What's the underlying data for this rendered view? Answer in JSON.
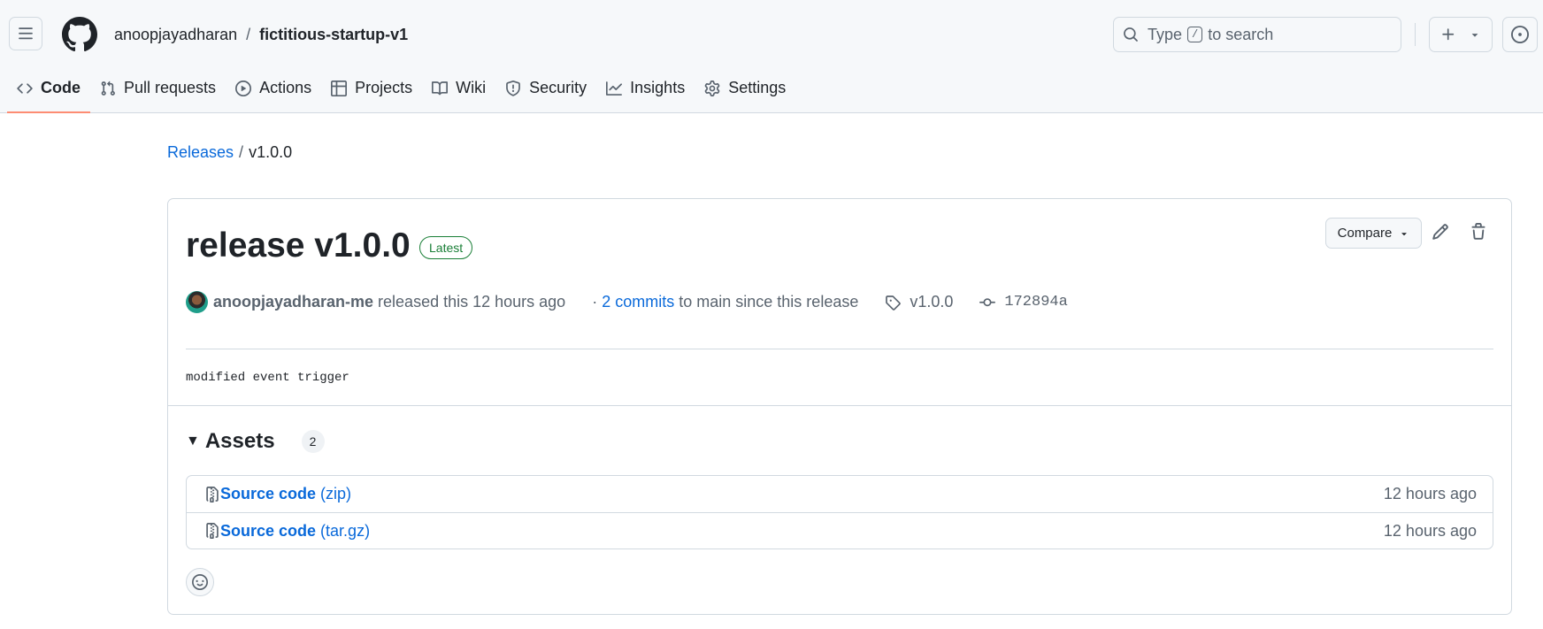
{
  "header": {
    "owner": "anoopjayadharan",
    "separator": "/",
    "repo": "fictitious-startup-v1",
    "search": {
      "prefix": "Type",
      "key": "/",
      "suffix": "to search"
    },
    "icons": [
      "menu-icon",
      "github-logo-icon",
      "search-icon",
      "plus-icon",
      "triangle-down-icon",
      "issue-opened-icon"
    ]
  },
  "tabs": [
    {
      "label": "Code",
      "icon": "code-icon",
      "selected": true
    },
    {
      "label": "Pull requests",
      "icon": "git-pull-request-icon"
    },
    {
      "label": "Actions",
      "icon": "play-icon"
    },
    {
      "label": "Projects",
      "icon": "table-icon"
    },
    {
      "label": "Wiki",
      "icon": "book-icon"
    },
    {
      "label": "Security",
      "icon": "shield-icon"
    },
    {
      "label": "Insights",
      "icon": "graph-icon"
    },
    {
      "label": "Settings",
      "icon": "gear-icon"
    }
  ],
  "breadcrumb": {
    "root": "Releases",
    "separator": "/",
    "current": "v1.0.0"
  },
  "release": {
    "title": "release v1.0.0",
    "badge": "Latest",
    "compare_label": "Compare",
    "author": "anoopjayadharan-me",
    "released_text": "released this 12 hours ago",
    "commits_prefix": "·",
    "commits_link": "2 commits",
    "commits_suffix": "to main since this release",
    "tag": "v1.0.0",
    "commit_sha": "172894a",
    "notes": "modified event trigger"
  },
  "assets": {
    "title": "Assets",
    "count": "2",
    "items": [
      {
        "name": "Source code",
        "ext": "(zip)",
        "time": "12 hours ago"
      },
      {
        "name": "Source code",
        "ext": "(tar.gz)",
        "time": "12 hours ago"
      }
    ]
  },
  "colors": {
    "link": "#0969da",
    "latest_badge": "#1a7f37",
    "tab_underline": "#fd8c73",
    "header_bg": "#f6f8fa",
    "border": "#d1d9e0"
  }
}
